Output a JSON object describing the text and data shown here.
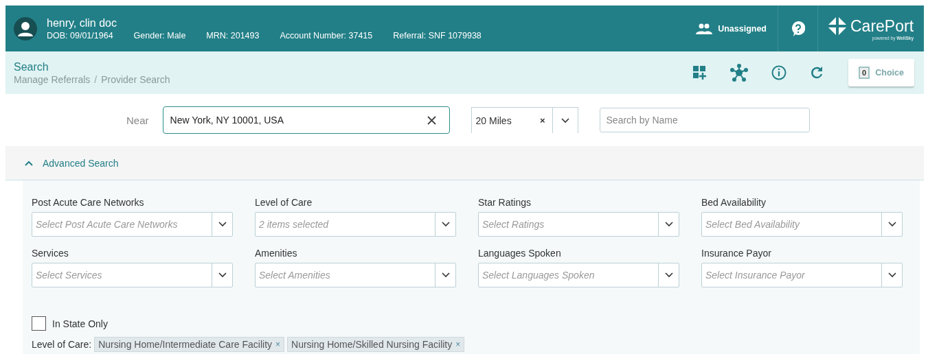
{
  "patient": {
    "name": "henry, clin doc",
    "details": [
      "DOB: 09/01/1964",
      "Gender: Male",
      "MRN: 201493",
      "Account Number: 37415",
      "Referral: SNF 1079938"
    ]
  },
  "header_actions": {
    "assignee": "Unassigned"
  },
  "logo": {
    "name": "CarePort",
    "tagline": "powered by",
    "brand": "WellSky"
  },
  "page": {
    "title": "Search",
    "breadcrumb": [
      "Manage Referrals",
      "Provider Search"
    ],
    "separator": "/"
  },
  "choice": {
    "count": "0",
    "label": "Choice"
  },
  "search": {
    "near_label": "Near",
    "near_value": "New York, NY 10001, USA",
    "radius": "20 Miles",
    "radius_clear": "×",
    "name_placeholder": "Search by Name"
  },
  "advanced": {
    "label": "Advanced Search",
    "expanded": true
  },
  "filters": [
    {
      "label": "Post Acute Care Networks",
      "placeholder": "Select Post Acute Care Networks"
    },
    {
      "label": "Level of Care",
      "placeholder": "2 items selected"
    },
    {
      "label": "Star Ratings",
      "placeholder": "Select Ratings"
    },
    {
      "label": "Bed Availability",
      "placeholder": "Select Bed Availability"
    },
    {
      "label": "Services",
      "placeholder": "Select Services"
    },
    {
      "label": "Amenities",
      "placeholder": "Select Amenities"
    },
    {
      "label": "Languages Spoken",
      "placeholder": "Select Languages Spoken"
    },
    {
      "label": "Insurance Payor",
      "placeholder": "Select Insurance Payor"
    }
  ],
  "in_state_only": {
    "label": "In State Only",
    "checked": false
  },
  "level_of_care_tags": {
    "label": "Level of Care:",
    "tags": [
      "Nursing Home/Intermediate Care Facility",
      "Nursing Home/Skilled Nursing Facility"
    ],
    "remove": "×"
  }
}
